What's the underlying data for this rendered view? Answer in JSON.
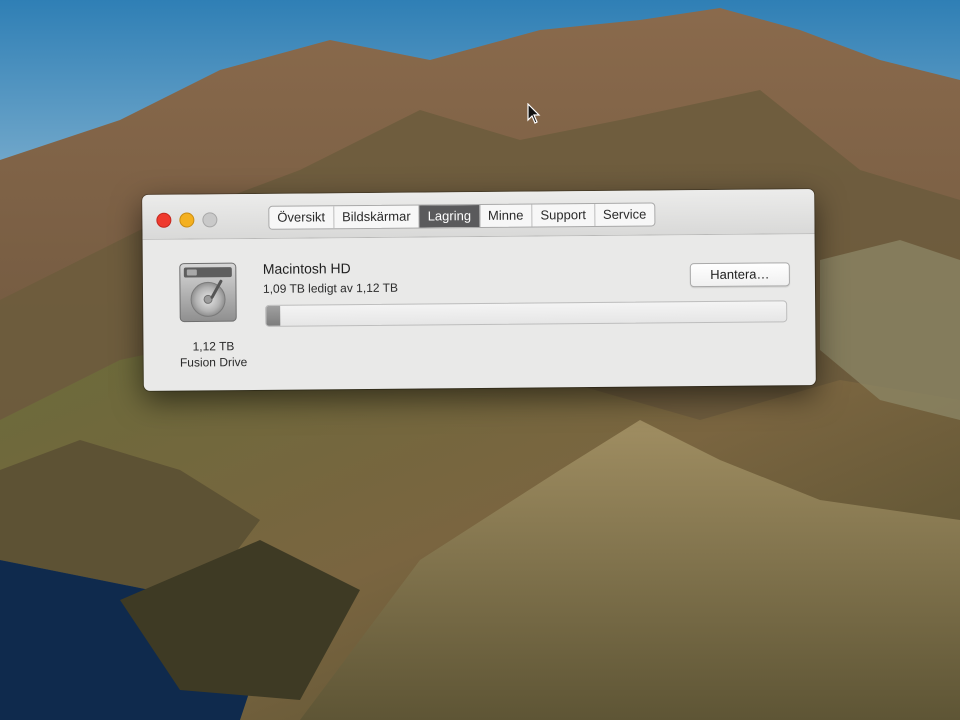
{
  "window": {
    "tabs": [
      {
        "label": "Översikt",
        "active": false
      },
      {
        "label": "Bildskärmar",
        "active": false
      },
      {
        "label": "Lagring",
        "active": true
      },
      {
        "label": "Minne",
        "active": false
      },
      {
        "label": "Support",
        "active": false
      },
      {
        "label": "Service",
        "active": false
      }
    ]
  },
  "storage": {
    "volume_name": "Macintosh HD",
    "free_text": "1,09 TB ledigt av 1,12 TB",
    "used_fraction": 0.027,
    "disk_size": "1,12 TB",
    "disk_type": "Fusion Drive",
    "manage_label": "Hantera…"
  },
  "icons": {
    "disk": "hard-drive-icon",
    "cursor": "mouse-pointer-icon"
  },
  "colors": {
    "close": "#ef3a2e",
    "minimize": "#f4b01f",
    "zoom": "#c9c9c9",
    "active_tab": "#5a5a5c"
  }
}
